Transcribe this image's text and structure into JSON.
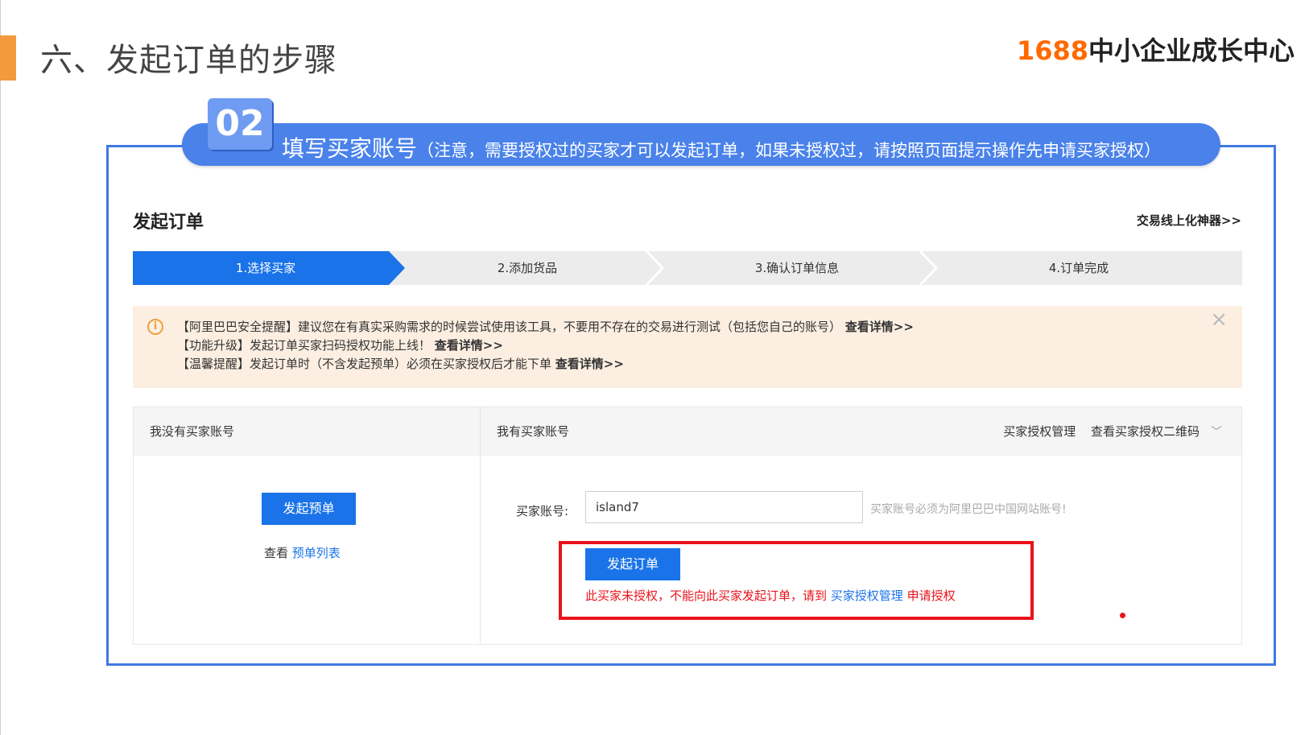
{
  "slide": {
    "title": "六、发起订单的步骤",
    "logo_number": "1688",
    "logo_text": "中小企业成长中心",
    "accent_color": "#f39a3c"
  },
  "banner": {
    "step_number": "02",
    "title": "填写买家账号",
    "note": "（注意，需要授权过的买家才可以发起订单，如果未授权过，请按照页面提示操作先申请买家授权）",
    "color": "#4a82ea"
  },
  "app": {
    "title": "发起订单",
    "tool_link": "交易线上化神器>>",
    "steps": [
      "1.选择买家",
      "2.添加货品",
      "3.确认订单信息",
      "4.订单完成"
    ],
    "active_step": 0,
    "notice": {
      "line1_prefix": "【阿里巴巴安全提醒】建议您在有真实采购需求的时候尝试使用该工具，不要用不存在的交易进行测试（包括您自己的账号）",
      "line1_link": "查看详情>>",
      "line2_prefix": "【功能升级】发起订单买家扫码授权功能上线！",
      "line2_link": "查看详情>>",
      "line3_prefix": "【温馨提醒】发起订单时（不含发起预单）必须在买家授权后才能下单",
      "line3_link": "查看详情>>",
      "close_icon": "close-icon"
    },
    "left_panel": {
      "header": "我没有买家账号",
      "button": "发起预单",
      "view_prefix": "查看",
      "view_link": "预单列表"
    },
    "right_panel": {
      "header": "我有买家账号",
      "link_manage": "买家授权管理",
      "link_qr": "查看买家授权二维码",
      "account_label": "买家账号:",
      "account_value": "island7",
      "account_hint": "买家账号必须为阿里巴巴中国网站账号!",
      "button": "发起订单",
      "error_prefix": "此买家未授权，不能向此买家发起订单，请到",
      "error_link": "买家授权管理",
      "error_suffix": "申请授权"
    },
    "primary_color": "#1a73e8",
    "error_color": "#e8131b"
  }
}
